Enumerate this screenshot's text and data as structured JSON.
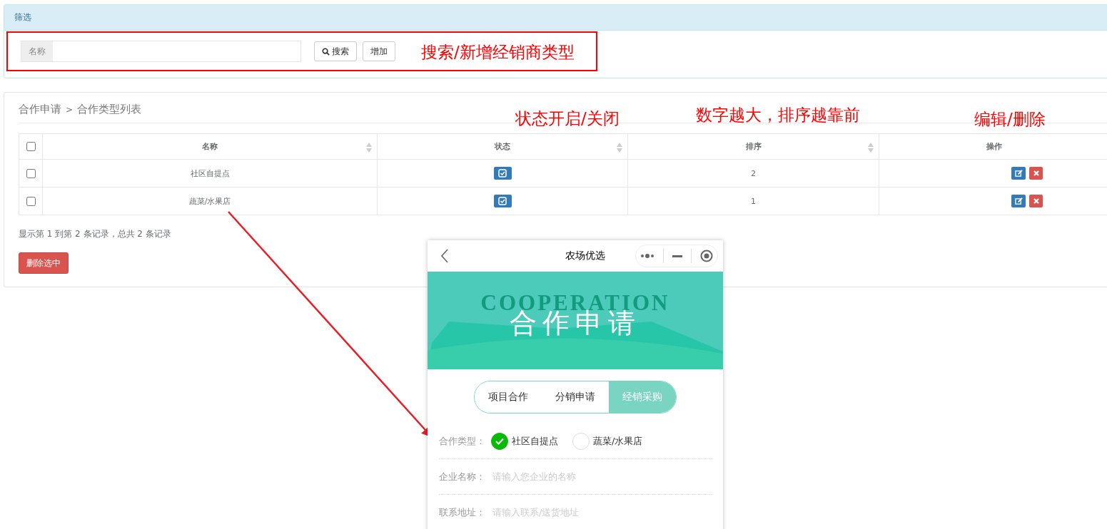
{
  "filter_panel": {
    "title": "筛选",
    "search_field": {
      "label": "名称"
    },
    "buttons": [
      {
        "kind": "search",
        "label": "搜索"
      },
      {
        "kind": "add",
        "label": "增加"
      }
    ]
  },
  "list_panel": {
    "breadcrumb": [
      "合作申请",
      "合作类型列表"
    ],
    "breadcrumb_separator": ">",
    "table": {
      "header_checked": false,
      "columns": [
        {
          "kind": "text",
          "label": "名称",
          "sortable": true
        },
        {
          "kind": "status",
          "label": "状态",
          "sortable": true
        },
        {
          "kind": "order",
          "label": "排序",
          "sortable": true
        },
        {
          "kind": "actions",
          "label": "操作",
          "sortable": false
        }
      ],
      "rows": [
        {
          "checked": false,
          "name": "社区自提点",
          "enabled": true,
          "order": "2"
        },
        {
          "checked": false,
          "name": "蔬菜/水果店",
          "enabled": true,
          "order": "1"
        }
      ]
    },
    "summary": "显示第 1 到第 2 条记录，总共 2 条记录",
    "delete_button": "删除选中"
  },
  "annotations": [
    {
      "text": "搜索/新增经销商类型"
    },
    {
      "text": "状态开启/关闭"
    },
    {
      "text": "数字越大，排序越靠前"
    },
    {
      "text": "编辑/删除"
    }
  ],
  "phone": {
    "title": "农场优选",
    "banner": {
      "watermark": "COOPERATION",
      "title": "合作申请"
    },
    "tabs": [
      {
        "label": "项目合作",
        "selected": false
      },
      {
        "label": "分销申请",
        "selected": false
      },
      {
        "label": "经销采购",
        "selected": true
      }
    ],
    "type_label": "合作类型：",
    "options": [
      {
        "label": "社区自提点",
        "selected": true
      },
      {
        "label": "蔬菜/水果店",
        "selected": false
      }
    ],
    "fields": [
      {
        "label": "企业名称：",
        "placeholder": "请输入您企业的名称"
      },
      {
        "label": "联系地址：",
        "placeholder": "请输入联系/送货地址"
      }
    ]
  }
}
